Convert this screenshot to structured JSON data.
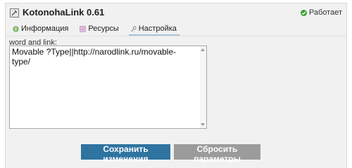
{
  "header": {
    "title": "KotonohaLink 0.61",
    "plugin_icon": "plugin-icon",
    "status": {
      "label": "Работает",
      "icon": "check-circle-icon",
      "color": "#3aa332"
    }
  },
  "tabs": [
    {
      "label": "Информация",
      "icon": "info-icon",
      "active": false
    },
    {
      "label": "Ресурсы",
      "icon": "resources-icon",
      "active": false
    },
    {
      "label": "Настройка",
      "icon": "settings-icon",
      "active": true
    }
  ],
  "form": {
    "field_label": "word and link:",
    "field_value": "Movable ?Type||http://narodlink.ru/movable-type/"
  },
  "buttons": {
    "save_label": "Сохранить изменения",
    "save_color": "#2f73a0",
    "reset_label": "Сбросить параметры",
    "reset_color": "#9b9b9b"
  }
}
